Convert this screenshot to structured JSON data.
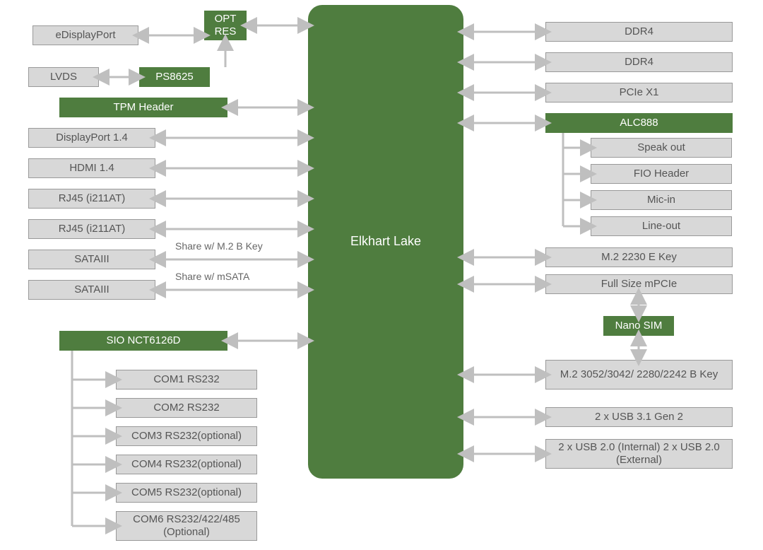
{
  "colors": {
    "green": "#4f7d3f",
    "gray": "#d8d8d8",
    "arrow": "#bfbfbf",
    "text": "#555"
  },
  "cpu": {
    "label": "Elkhart Lake"
  },
  "left": {
    "edp": "eDisplayPort",
    "optres": "OPT RES",
    "lvds": "LVDS",
    "ps8625": "PS8625",
    "tpm": "TPM Header",
    "dp14": "DisplayPort 1.4",
    "hdmi14": "HDMI 1.4",
    "rj45a": "RJ45 (i211AT)",
    "rj45b": "RJ45 (i211AT)",
    "sata1": "SATAIII",
    "sata2": "SATAIII",
    "share_m2": "Share w/ M.2 B Key",
    "share_msata": "Share w/ mSATA",
    "sio": "SIO NCT6126D",
    "com1": "COM1 RS232",
    "com2": "COM2 RS232",
    "com3": "COM3 RS232(optional)",
    "com4": "COM4 RS232(optional)",
    "com5": "COM5 RS232(optional)",
    "com6": "COM6 RS232/422/485 (Optional)"
  },
  "right": {
    "ddr4a": "DDR4",
    "ddr4b": "DDR4",
    "pciex1": "PCIe X1",
    "alc888": "ALC888",
    "speakout": "Speak out",
    "fioheader": "FIO Header",
    "micin": "Mic-in",
    "lineout": "Line-out",
    "m2e": "M.2 2230 E Key",
    "mpcie": "Full Size mPCIe",
    "nanosim": "Nano SIM",
    "m2b": "M.2 3052/3042/ 2280/2242 B Key",
    "usb31": "2 x USB 3.1 Gen 2",
    "usb20": "2 x USB 2.0 (Internal) 2 x USB 2.0 (External)"
  }
}
